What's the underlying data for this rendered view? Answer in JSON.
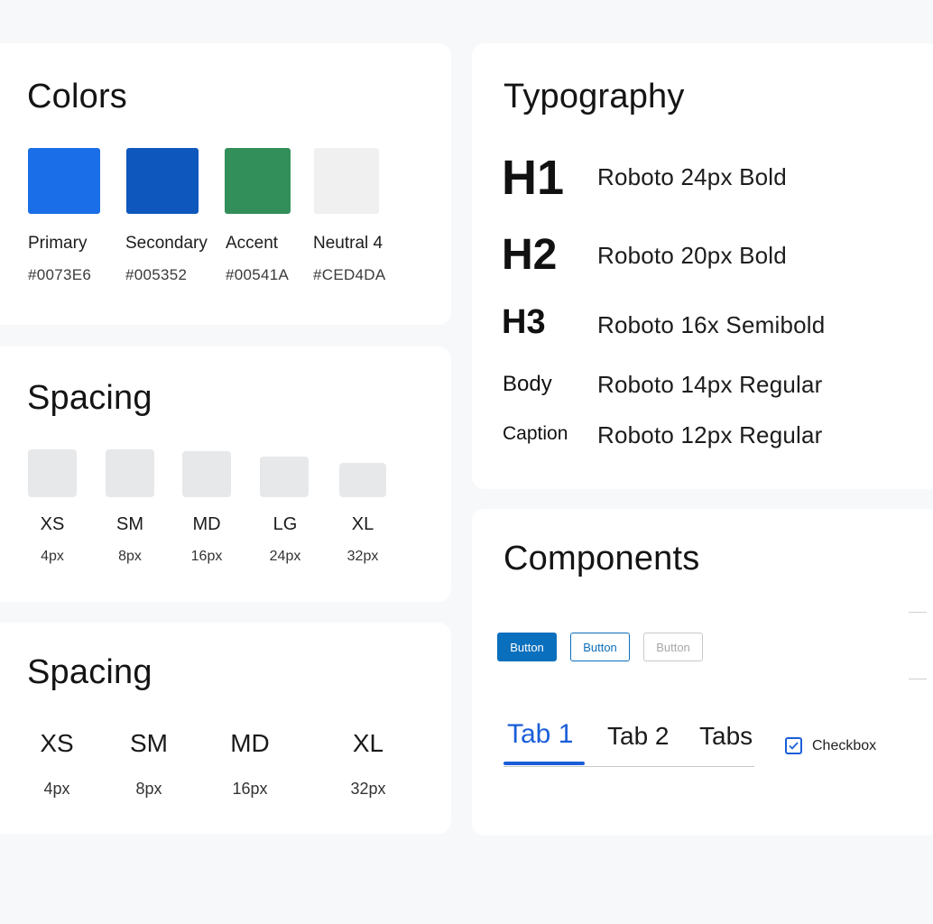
{
  "colors": {
    "title": "Colors",
    "swatches": [
      {
        "name": "Primary",
        "hex": "#0073E6",
        "fill": "#1a6fe8"
      },
      {
        "name": "Secondary",
        "hex": "#005352",
        "fill": "#0e57bd"
      },
      {
        "name": "Accent",
        "hex": "#00541A",
        "fill": "#338f5a"
      },
      {
        "name": "Neutral 4",
        "hex": "#CED4DA",
        "fill": "#f0f0f0"
      }
    ]
  },
  "spacing_small": {
    "title": "Spacing",
    "items": [
      {
        "name": "XS",
        "value": "4px"
      },
      {
        "name": "SM",
        "value": "8px"
      },
      {
        "name": "MD",
        "value": "16px"
      },
      {
        "name": "LG",
        "value": "24px"
      },
      {
        "name": "XL",
        "value": "32px"
      }
    ]
  },
  "spacing_large": {
    "title": "Spacing",
    "items": [
      {
        "name": "XS",
        "value": "4px"
      },
      {
        "name": "SM",
        "value": "8px"
      },
      {
        "name": "MD",
        "value": "16px"
      },
      {
        "name": "XL",
        "value": "32px"
      }
    ]
  },
  "typography": {
    "title": "Typography",
    "rows": [
      {
        "label": "H1",
        "desc": "Roboto 24px  Bold"
      },
      {
        "label": "H2",
        "desc": "Roboto 20px  Bold"
      },
      {
        "label": "H3",
        "desc": "Roboto 16x  Semibold"
      },
      {
        "label": "Body",
        "desc": "Roboto 14px Regular"
      },
      {
        "label": "Caption",
        "desc": "Roboto 12px Regular"
      }
    ]
  },
  "components": {
    "title": "Components",
    "buttons": {
      "primary_label": "Button",
      "outline_label": "Button",
      "disabled_label": "Button"
    },
    "tabs": [
      {
        "label": "Tab 1",
        "active": true
      },
      {
        "label": "Tab 2",
        "active": false
      },
      {
        "label": "Tabs",
        "active": false
      }
    ],
    "checkbox": {
      "label": "Checkbox",
      "checked": true
    }
  },
  "theme": {
    "accent": "#1a5ed9",
    "button_primary": "#0a6fbd",
    "page_bg": "#f7f8fa",
    "card_bg": "#ffffff"
  }
}
